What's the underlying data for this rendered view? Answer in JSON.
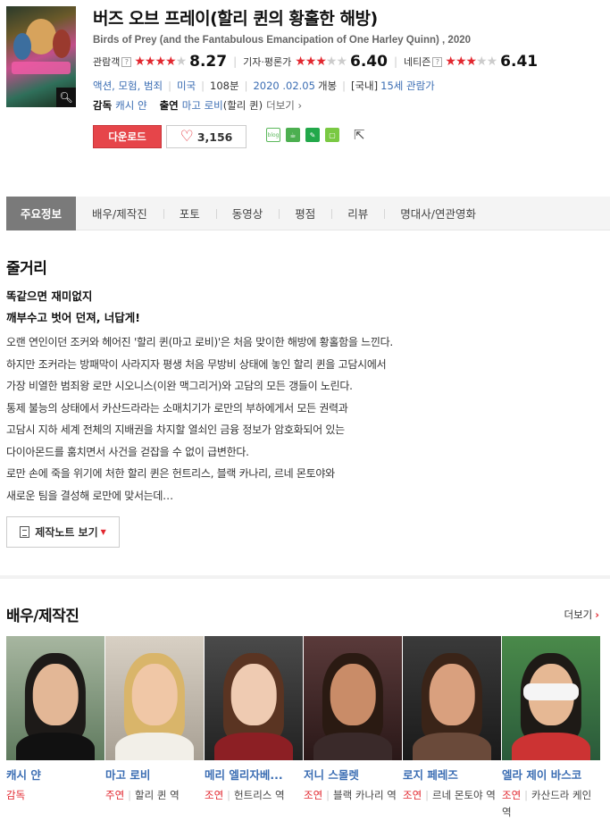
{
  "movie": {
    "title": "버즈 오브 프레이(할리 퀸의 황홀한 해방)",
    "subtitle": "Birds of Prey (and the Fantabulous Emancipation of One Harley Quinn) , 2020",
    "ratings": [
      {
        "label": "관람객",
        "help": "?",
        "stars_on": "★★★★",
        "stars_off": "★",
        "score": "8.27"
      },
      {
        "label": "기자·평론가",
        "help": "",
        "stars_on": "★★★",
        "stars_off": "★★",
        "score": "6.40"
      },
      {
        "label": "네티즌",
        "help": "?",
        "stars_on": "★★★",
        "stars_off": "★★",
        "score": "6.41"
      }
    ],
    "meta": {
      "genres": "액션, 모험, 범죄",
      "country": "미국",
      "runtime": "108분",
      "release_date": "2020 .02.05",
      "release_suffix": "개봉",
      "rating_region": "[국내]",
      "rating_grade": "15세 관람가"
    },
    "director_label": "감독",
    "director": "캐시 얀",
    "cast_label": "출연",
    "cast_name": "마고 로비",
    "cast_role": "(할리 퀸)",
    "more_label": "더보기",
    "download_label": "다운로드",
    "like_count": "3,156"
  },
  "tabs": [
    "주요정보",
    "배우/제작진",
    "포토",
    "동영상",
    "평점",
    "리뷰",
    "명대사/연관영화"
  ],
  "synopsis": {
    "heading": "줄거리",
    "tagline1": "똑같으면 재미없지",
    "tagline2": "깨부수고 벗어 던져, 너답게!",
    "body": "오랜 연인이던 조커와 헤어진 '할리 퀸(마고 로비)'은 처음 맞이한 해방에 황홀함을 느낀다.\n 하지만 조커라는 방패막이 사라지자 평생 처음 무방비 상태에 놓인 할리 퀸을 고담시에서\n 가장 비열한 범죄왕 로만 시오니스(이완 맥그리거)와 고담의 모든 갱들이 노린다.\n 통제 불능의 상태에서 카산드라라는 소매치기가 로만의 부하에게서 모든 권력과\n 고담시 지하 세계 전체의 지배권을 차지할 열쇠인 금융 정보가 암호화되어 있는\n 다이아몬드를 훔치면서 사건을 걷잡을 수 없이 급변한다.\n 로만 손에 죽을 위기에 처한 할리 퀸은 헌트리스, 블랙 카나리, 르네 몬토야와\n 새로운 팀을 결성해 로만에 맞서는데…",
    "notes_button": "제작노트 보기"
  },
  "cast_section": {
    "heading": "배우/제작진",
    "more_label": "더보기",
    "people": [
      {
        "name": "캐시 얀",
        "type": "감독",
        "role": ""
      },
      {
        "name": "마고 로비",
        "type": "주연",
        "role": "할리 퀸 역"
      },
      {
        "name": "메리 엘리자베...",
        "type": "조연",
        "role": "헌트리스 역"
      },
      {
        "name": "저니 스몰렛",
        "type": "조연",
        "role": "블랙 카나리 역"
      },
      {
        "name": "로지 페레즈",
        "type": "조연",
        "role": "르네 몬토야 역"
      },
      {
        "name": "엘라 제이 바스코",
        "type": "조연",
        "role": "카산드라 케인 역"
      }
    ]
  },
  "colors": {
    "accent_red": "#e2272f",
    "link_blue": "#3b6db3",
    "tab_active": "#7a7a7a"
  }
}
